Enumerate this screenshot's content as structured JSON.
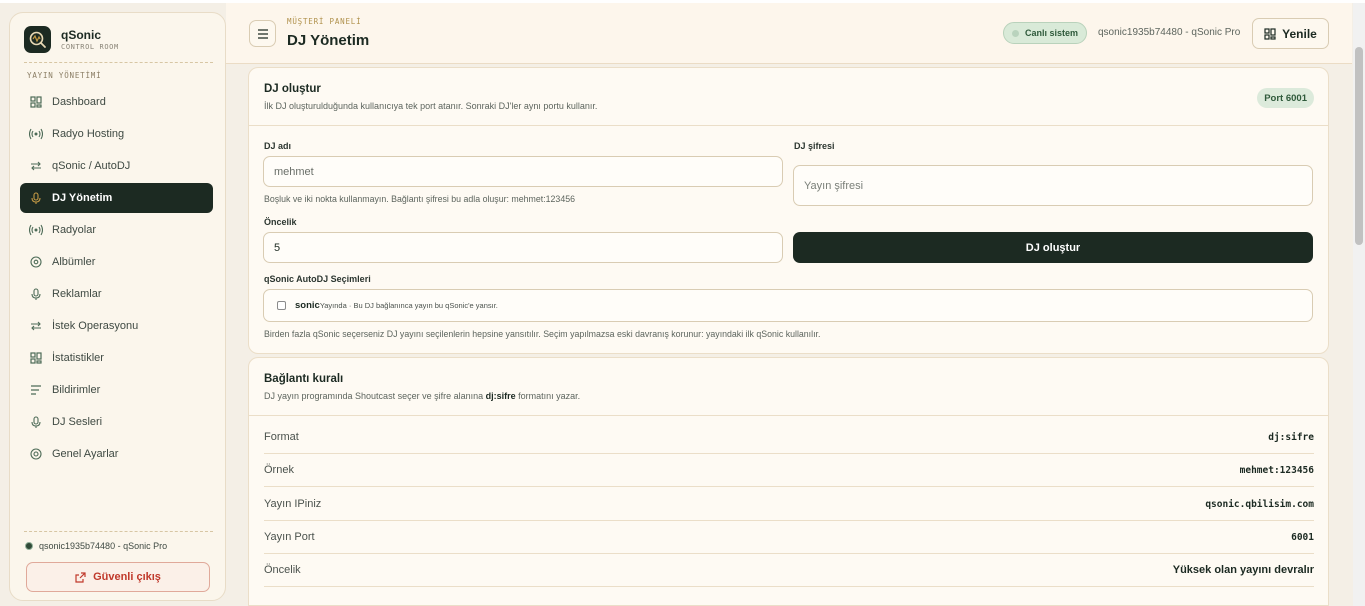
{
  "brand": {
    "name": "qSonic",
    "subtitle": "CONTROL ROOM"
  },
  "sidebar": {
    "section_label": "YAYIN YÖNETİMİ",
    "items": [
      {
        "label": "Dashboard",
        "icon": "grid-icon"
      },
      {
        "label": "Radyo Hosting",
        "icon": "radio-waves-icon"
      },
      {
        "label": "qSonic / AutoDJ",
        "icon": "swap-arrows-icon"
      },
      {
        "label": "DJ Yönetim",
        "icon": "microphone-icon",
        "active": true
      },
      {
        "label": "Radyolar",
        "icon": "radio-waves-icon"
      },
      {
        "label": "Albümler",
        "icon": "disc-icon"
      },
      {
        "label": "Reklamlar",
        "icon": "microphone-icon"
      },
      {
        "label": "İstek Operasyonu",
        "icon": "swap-arrows-icon"
      },
      {
        "label": "İstatistikler",
        "icon": "grid-icon"
      },
      {
        "label": "Bildirimler",
        "icon": "lines-icon"
      },
      {
        "label": "DJ Sesleri",
        "icon": "microphone-icon"
      },
      {
        "label": "Genel Ayarlar",
        "icon": "settings-icon"
      }
    ],
    "user": "qsonic1935b74480 - qSonic Pro",
    "logout_label": "Güvenli çıkış"
  },
  "header": {
    "kicker": "MÜŞTERİ PANELİ",
    "title": "DJ Yönetim",
    "live_label": "Canlı sistem",
    "account": "qsonic1935b74480 - qSonic Pro",
    "refresh_label": "Yenile"
  },
  "create_card": {
    "title": "DJ oluştur",
    "description": "İlk DJ oluşturulduğunda kullanıcıya tek port atanır. Sonraki DJ'ler aynı portu kullanır.",
    "port_badge": "Port 6001",
    "dj_name_label": "DJ adı",
    "dj_name_value": "mehmet",
    "dj_name_help": "Boşluk ve iki nokta kullanmayın. Bağlantı şifresi bu adla oluşur: mehmet:123456",
    "dj_password_label": "DJ şifresi",
    "dj_password_placeholder": "Yayın şifresi",
    "priority_label": "Öncelik",
    "priority_value": "5",
    "create_button": "DJ oluştur",
    "autodj_label": "qSonic AutoDJ Seçimleri",
    "autodj_option_name": "sonic",
    "autodj_option_note": "Yayında · Bu DJ bağlanınca yayın bu qSonic'e yansır.",
    "autodj_help": "Birden fazla qSonic seçerseniz DJ yayını seçilenlerin hepsine yansıtılır. Seçim yapılmazsa eski davranış korunur: yayındaki ilk qSonic kullanılır."
  },
  "rules_card": {
    "title": "Bağlantı kuralı",
    "desc_before": "DJ yayın programında Shoutcast seçer ve şifre alanına ",
    "desc_bold": "dj:sifre",
    "desc_after": " formatını yazar.",
    "rows": [
      {
        "key": "Format",
        "value": "dj:sifre",
        "mono": true
      },
      {
        "key": "Örnek",
        "value": "mehmet:123456",
        "mono": true
      },
      {
        "key": "Yayın IPiniz",
        "value": "qsonic.qbilisim.com",
        "mono": true
      },
      {
        "key": "Yayın Port",
        "value": "6001",
        "mono": true
      },
      {
        "key": "Öncelik",
        "value": "Yüksek olan yayını devralır",
        "mono": false
      }
    ]
  },
  "colors": {
    "accent_dark": "#1c2a22",
    "accent_gold": "#c49a45",
    "danger": "#c0392b",
    "success": "#2f5a3b"
  }
}
